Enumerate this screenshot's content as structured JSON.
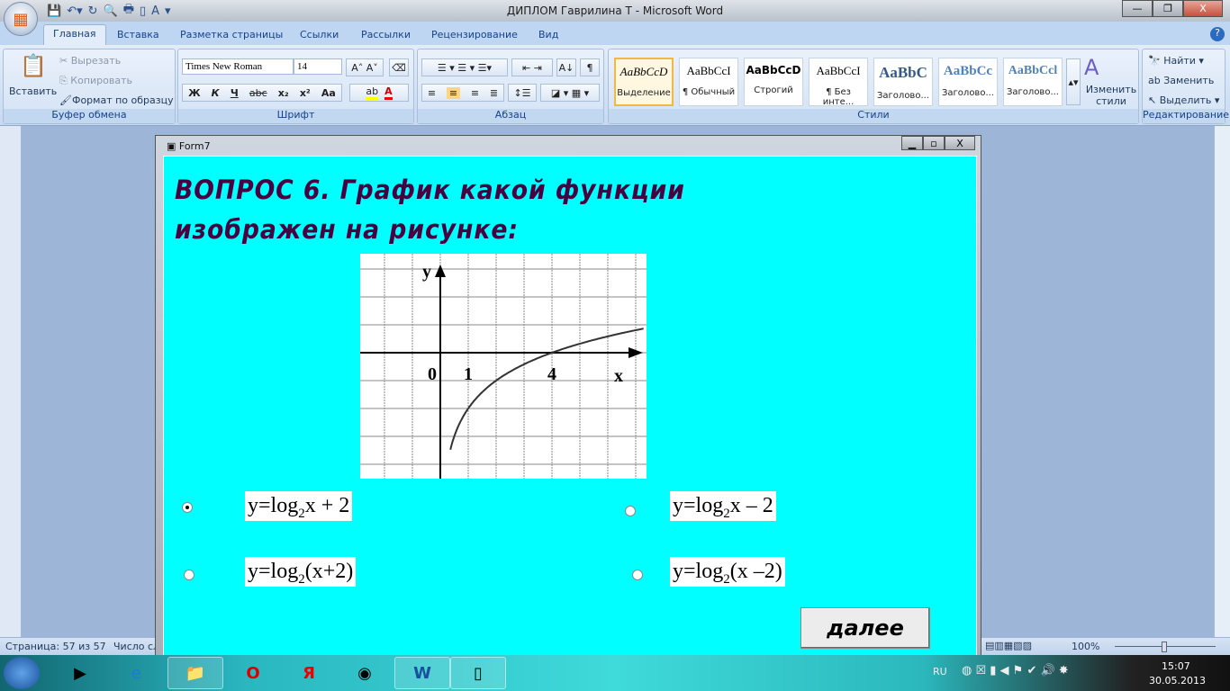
{
  "window": {
    "title": "ДИПЛОМ Гаврилина Т - Microsoft Word",
    "minimize": "—",
    "restore": "❐",
    "close": "X"
  },
  "tabs": [
    "Главная",
    "Вставка",
    "Разметка страницы",
    "Ссылки",
    "Рассылки",
    "Рецензирование",
    "Вид"
  ],
  "clipboard": {
    "paste": "Вставить",
    "cut": "Вырезать",
    "copy": "Копировать",
    "format_painter": "Формат по образцу",
    "label": "Буфер обмена"
  },
  "font": {
    "name": "Times New Roman",
    "size": "14",
    "label": "Шрифт",
    "bold": "Ж",
    "italic": "К",
    "underline": "Ч",
    "strike": "abc",
    "sub": "x₂",
    "sup": "x²",
    "case": "Aa",
    "grow": "A˄",
    "shrink": "A˅"
  },
  "paragraph": {
    "label": "Абзац",
    "pilcrow": "¶"
  },
  "styles": {
    "label": "Стили",
    "items": [
      {
        "sample": "AaBbCcD",
        "name": "Выделение"
      },
      {
        "sample": "AaBbCcI",
        "name": "¶ Обычный"
      },
      {
        "sample": "AaBbCcD",
        "name": "Строгий"
      },
      {
        "sample": "AaBbCcI",
        "name": "¶ Без инте..."
      },
      {
        "sample": "AaBbC",
        "name": "Заголово..."
      },
      {
        "sample": "AaBbCc",
        "name": "Заголово..."
      },
      {
        "sample": "AaBbCcl",
        "name": "Заголово..."
      }
    ],
    "change": "Изменить стили"
  },
  "editing": {
    "label": "Редактирование",
    "find": "Найти",
    "replace": "Заменить",
    "select": "Выделить"
  },
  "status": {
    "page": "Страница: 57 из 57",
    "words": "Число сл",
    "zoom": "100%"
  },
  "form": {
    "title": "Form7",
    "question_line1": "ВОПРОС 6. График какой функции",
    "question_line2": "изображен на рисунке:",
    "next": "далее",
    "options": [
      {
        "pre": "y=log",
        "sub": "2",
        "post": "x + 2",
        "selected": true
      },
      {
        "pre": "y=log",
        "sub": "2",
        "post": "x – 2",
        "selected": false
      },
      {
        "pre": "y=log",
        "sub": "2",
        "post": "(x+2)",
        "selected": false
      },
      {
        "pre": "y=log",
        "sub": "2",
        "post": "(x –2)",
        "selected": false
      }
    ]
  },
  "graph": {
    "function": "log2(x) - 2",
    "x_label": "x",
    "y_label": "y",
    "tick_labels": [
      "0",
      "1",
      "4"
    ],
    "x_range": [
      -3,
      7.3
    ],
    "y_range": [
      -4,
      3
    ]
  },
  "taskbar": {
    "lang": "RU",
    "time": "15:07",
    "date": "30.05.2013"
  }
}
